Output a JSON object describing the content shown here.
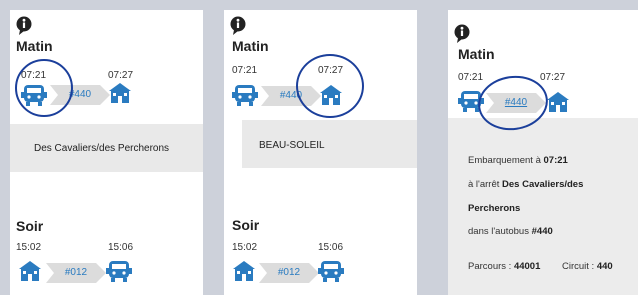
{
  "panels": [
    {
      "morning_title": "Matin",
      "morning_depart_time": "07:21",
      "morning_arrive_time": "07:27",
      "morning_route": "#440",
      "stop_box": "Des Cavaliers/des Percherons",
      "evening_title": "Soir",
      "evening_depart_time": "15:02",
      "evening_arrive_time": "15:06",
      "evening_route": "#012"
    },
    {
      "morning_title": "Matin",
      "morning_depart_time": "07:21",
      "morning_arrive_time": "07:27",
      "morning_route": "#440",
      "stop_box": "BEAU-SOLEIL",
      "evening_title": "Soir",
      "evening_depart_time": "15:02",
      "evening_arrive_time": "15:06",
      "evening_route": "#012"
    },
    {
      "morning_title": "Matin",
      "morning_depart_time": "07:21",
      "morning_arrive_time": "07:27",
      "morning_route": "#440",
      "details": {
        "line1_prefix": "Embarquement à ",
        "line1_time": "07:21",
        "line2_prefix": "à l'arrêt ",
        "line2_stop_a": "Des Cavaliers/des",
        "line3_stop_b": "Percherons",
        "line4_prefix": "dans l'autobus ",
        "line4_bus": "#440",
        "parcours_label": "Parcours : ",
        "parcours_value": "44001",
        "circuit_label": "Circuit : ",
        "circuit_value": "440"
      }
    }
  ],
  "icons": [
    "info-icon",
    "bus-icon",
    "school-icon"
  ],
  "colors": {
    "accent_blue": "#2a7bc0",
    "annotation_circle": "#1b3f9b",
    "background": "#cdd1da",
    "box_gray": "#e9e9e9"
  }
}
